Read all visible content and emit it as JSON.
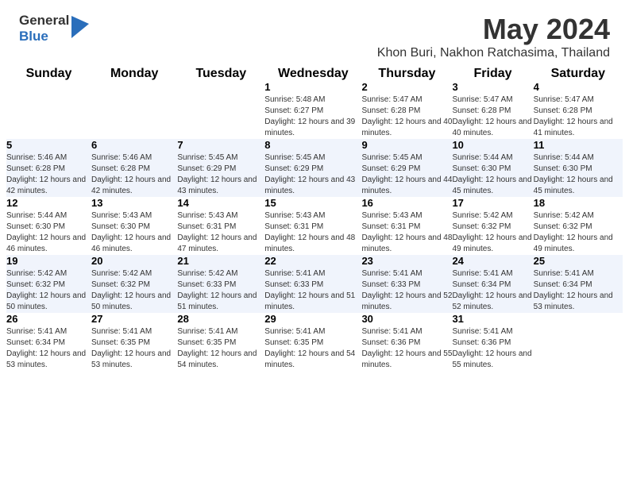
{
  "header": {
    "logo_general": "General",
    "logo_blue": "Blue",
    "month_year": "May 2024",
    "location": "Khon Buri, Nakhon Ratchasima, Thailand"
  },
  "days_of_week": [
    "Sunday",
    "Monday",
    "Tuesday",
    "Wednesday",
    "Thursday",
    "Friday",
    "Saturday"
  ],
  "weeks": [
    [
      {
        "num": "",
        "info": ""
      },
      {
        "num": "",
        "info": ""
      },
      {
        "num": "",
        "info": ""
      },
      {
        "num": "1",
        "info": "Sunrise: 5:48 AM\nSunset: 6:27 PM\nDaylight: 12 hours and 39 minutes."
      },
      {
        "num": "2",
        "info": "Sunrise: 5:47 AM\nSunset: 6:28 PM\nDaylight: 12 hours and 40 minutes."
      },
      {
        "num": "3",
        "info": "Sunrise: 5:47 AM\nSunset: 6:28 PM\nDaylight: 12 hours and 40 minutes."
      },
      {
        "num": "4",
        "info": "Sunrise: 5:47 AM\nSunset: 6:28 PM\nDaylight: 12 hours and 41 minutes."
      }
    ],
    [
      {
        "num": "5",
        "info": "Sunrise: 5:46 AM\nSunset: 6:28 PM\nDaylight: 12 hours and 42 minutes."
      },
      {
        "num": "6",
        "info": "Sunrise: 5:46 AM\nSunset: 6:28 PM\nDaylight: 12 hours and 42 minutes."
      },
      {
        "num": "7",
        "info": "Sunrise: 5:45 AM\nSunset: 6:29 PM\nDaylight: 12 hours and 43 minutes."
      },
      {
        "num": "8",
        "info": "Sunrise: 5:45 AM\nSunset: 6:29 PM\nDaylight: 12 hours and 43 minutes."
      },
      {
        "num": "9",
        "info": "Sunrise: 5:45 AM\nSunset: 6:29 PM\nDaylight: 12 hours and 44 minutes."
      },
      {
        "num": "10",
        "info": "Sunrise: 5:44 AM\nSunset: 6:30 PM\nDaylight: 12 hours and 45 minutes."
      },
      {
        "num": "11",
        "info": "Sunrise: 5:44 AM\nSunset: 6:30 PM\nDaylight: 12 hours and 45 minutes."
      }
    ],
    [
      {
        "num": "12",
        "info": "Sunrise: 5:44 AM\nSunset: 6:30 PM\nDaylight: 12 hours and 46 minutes."
      },
      {
        "num": "13",
        "info": "Sunrise: 5:43 AM\nSunset: 6:30 PM\nDaylight: 12 hours and 46 minutes."
      },
      {
        "num": "14",
        "info": "Sunrise: 5:43 AM\nSunset: 6:31 PM\nDaylight: 12 hours and 47 minutes."
      },
      {
        "num": "15",
        "info": "Sunrise: 5:43 AM\nSunset: 6:31 PM\nDaylight: 12 hours and 48 minutes."
      },
      {
        "num": "16",
        "info": "Sunrise: 5:43 AM\nSunset: 6:31 PM\nDaylight: 12 hours and 48 minutes."
      },
      {
        "num": "17",
        "info": "Sunrise: 5:42 AM\nSunset: 6:32 PM\nDaylight: 12 hours and 49 minutes."
      },
      {
        "num": "18",
        "info": "Sunrise: 5:42 AM\nSunset: 6:32 PM\nDaylight: 12 hours and 49 minutes."
      }
    ],
    [
      {
        "num": "19",
        "info": "Sunrise: 5:42 AM\nSunset: 6:32 PM\nDaylight: 12 hours and 50 minutes."
      },
      {
        "num": "20",
        "info": "Sunrise: 5:42 AM\nSunset: 6:32 PM\nDaylight: 12 hours and 50 minutes."
      },
      {
        "num": "21",
        "info": "Sunrise: 5:42 AM\nSunset: 6:33 PM\nDaylight: 12 hours and 51 minutes."
      },
      {
        "num": "22",
        "info": "Sunrise: 5:41 AM\nSunset: 6:33 PM\nDaylight: 12 hours and 51 minutes."
      },
      {
        "num": "23",
        "info": "Sunrise: 5:41 AM\nSunset: 6:33 PM\nDaylight: 12 hours and 52 minutes."
      },
      {
        "num": "24",
        "info": "Sunrise: 5:41 AM\nSunset: 6:34 PM\nDaylight: 12 hours and 52 minutes."
      },
      {
        "num": "25",
        "info": "Sunrise: 5:41 AM\nSunset: 6:34 PM\nDaylight: 12 hours and 53 minutes."
      }
    ],
    [
      {
        "num": "26",
        "info": "Sunrise: 5:41 AM\nSunset: 6:34 PM\nDaylight: 12 hours and 53 minutes."
      },
      {
        "num": "27",
        "info": "Sunrise: 5:41 AM\nSunset: 6:35 PM\nDaylight: 12 hours and 53 minutes."
      },
      {
        "num": "28",
        "info": "Sunrise: 5:41 AM\nSunset: 6:35 PM\nDaylight: 12 hours and 54 minutes."
      },
      {
        "num": "29",
        "info": "Sunrise: 5:41 AM\nSunset: 6:35 PM\nDaylight: 12 hours and 54 minutes."
      },
      {
        "num": "30",
        "info": "Sunrise: 5:41 AM\nSunset: 6:36 PM\nDaylight: 12 hours and 55 minutes."
      },
      {
        "num": "31",
        "info": "Sunrise: 5:41 AM\nSunset: 6:36 PM\nDaylight: 12 hours and 55 minutes."
      },
      {
        "num": "",
        "info": ""
      }
    ]
  ]
}
